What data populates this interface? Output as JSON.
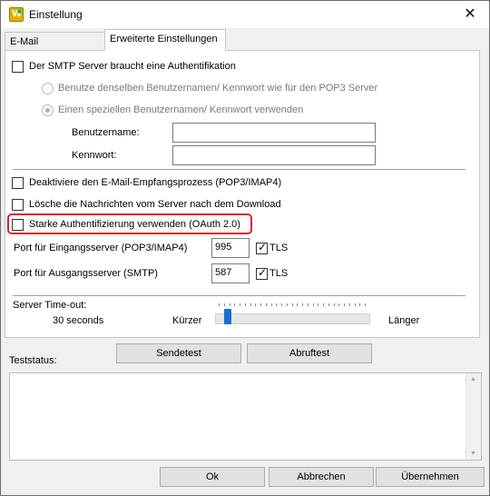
{
  "window": {
    "title": "Einstellung",
    "app_icon_letter": "W"
  },
  "tabs": [
    {
      "label": "E-Mail Einstellungen",
      "active": false
    },
    {
      "label": "Erweiterte Einstellungen",
      "active": true
    }
  ],
  "auth": {
    "smtp_auth_label": "Der SMTP Server braucht eine Authentifikation",
    "smtp_auth_checked": false,
    "radio_same_label": "Benutze denselben Benutzernamen/ Kennwort wie für den POP3 Server",
    "radio_same_checked": false,
    "radio_special_label": "Einen speziellen Benutzernamen/ Kennwort verwenden",
    "radio_special_checked": true,
    "username_label": "Benutzername:",
    "username_value": "",
    "password_label": "Kennwort:",
    "password_value": ""
  },
  "options": {
    "disable_receive_label": "Deaktiviere den E-Mail-Empfangsprozess (POP3/IMAP4)",
    "delete_after_download_label": "Lösche die Nachrichten vom Server nach dem Download",
    "oauth_label": "Starke Authentifizierung verwenden (OAuth 2.0)"
  },
  "ports": {
    "incoming_label": "Port für Eingangsserver (POP3/IMAP4)",
    "incoming_value": "995",
    "incoming_tls_label": "TLS",
    "incoming_tls_checked": true,
    "outgoing_label": "Port für Ausgangsserver (SMTP)",
    "outgoing_value": "587",
    "outgoing_tls_label": "TLS",
    "outgoing_tls_checked": true
  },
  "timeout": {
    "label": "Server Time-out:",
    "value_text": "30 seconds",
    "shorter_label": "Kürzer",
    "longer_label": "Länger",
    "slider_fraction": 0.05
  },
  "test": {
    "send_button": "Sendetest",
    "fetch_button": "Abruftest",
    "status_label": "Teststatus:",
    "status_text": ""
  },
  "footer": {
    "ok_button": "Ok",
    "cancel_button": "Abbrechen",
    "apply_button": "Übernehmen"
  },
  "colors": {
    "highlight": "#e0202a",
    "slider_thumb": "#1a6fd0",
    "app_icon": "#e2b000"
  },
  "icons": [
    "app-icon",
    "close-icon",
    "checkbox",
    "radio-button",
    "slider-thumb"
  ]
}
